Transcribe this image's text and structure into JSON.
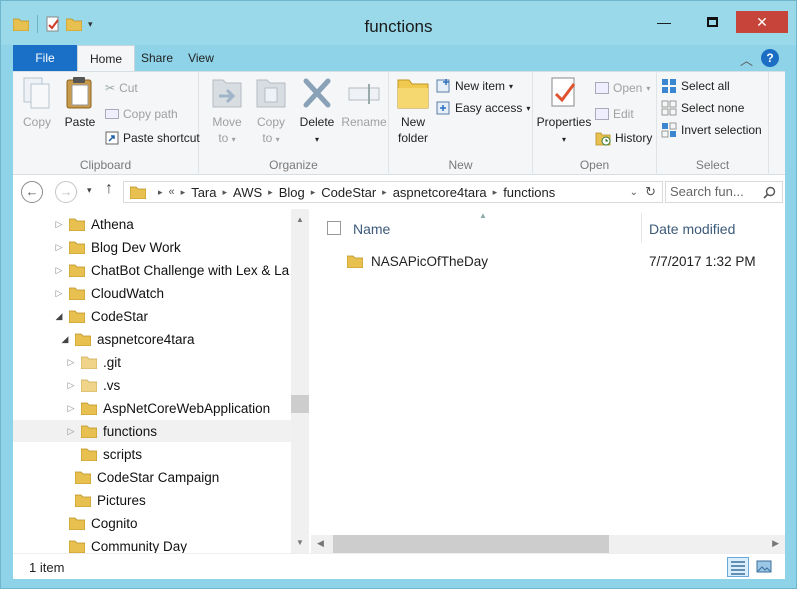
{
  "window": {
    "title": "functions"
  },
  "ribbon_tabs": [
    {
      "label": "File"
    },
    {
      "label": "Home"
    },
    {
      "label": "Share"
    },
    {
      "label": "View"
    }
  ],
  "clipboard": {
    "copy": "Copy",
    "paste": "Paste",
    "cut": "Cut",
    "copy_path": "Copy path",
    "paste_shortcut": "Paste shortcut",
    "group": "Clipboard"
  },
  "organize": {
    "move_to_1": "Move",
    "move_to_2": "to",
    "copy_to_1": "Copy",
    "copy_to_2": "to",
    "delete": "Delete",
    "rename": "Rename",
    "group": "Organize"
  },
  "new_group": {
    "new_folder_1": "New",
    "new_folder_2": "folder",
    "new_item": "New item",
    "easy_access": "Easy access",
    "group": "New"
  },
  "open_group": {
    "properties": "Properties",
    "open": "Open",
    "edit": "Edit",
    "history": "History",
    "group": "Open"
  },
  "select_group": {
    "select_all": "Select all",
    "select_none": "Select none",
    "invert": "Invert selection",
    "group": "Select"
  },
  "address": {
    "overflow": "«",
    "crumbs": [
      "Tara",
      "AWS",
      "Blog",
      "CodeStar",
      "aspnetcore4tara",
      "functions"
    ],
    "search_placeholder": "Search fun..."
  },
  "tree": [
    {
      "label": "Athena"
    },
    {
      "label": "Blog Dev Work"
    },
    {
      "label": "ChatBot Challenge with Lex & La"
    },
    {
      "label": "CloudWatch"
    },
    {
      "label": "CodeStar"
    },
    {
      "label": "aspnetcore4tara"
    },
    {
      "label": ".git"
    },
    {
      "label": ".vs"
    },
    {
      "label": "AspNetCoreWebApplication"
    },
    {
      "label": "functions"
    },
    {
      "label": "scripts"
    },
    {
      "label": "CodeStar Campaign"
    },
    {
      "label": "Pictures"
    },
    {
      "label": "Cognito"
    },
    {
      "label": "Community Day"
    }
  ],
  "columns": {
    "name": "Name",
    "date": "Date modified"
  },
  "files": [
    {
      "name": "NASAPicOfTheDay",
      "date": "7/7/2017 1:32 PM"
    }
  ],
  "status": {
    "count": "1 item"
  },
  "colors": {
    "titlebar": "#99d9ea",
    "file_tab": "#1a6fc7",
    "close": "#c7443a",
    "folder": "#e8c04f"
  }
}
